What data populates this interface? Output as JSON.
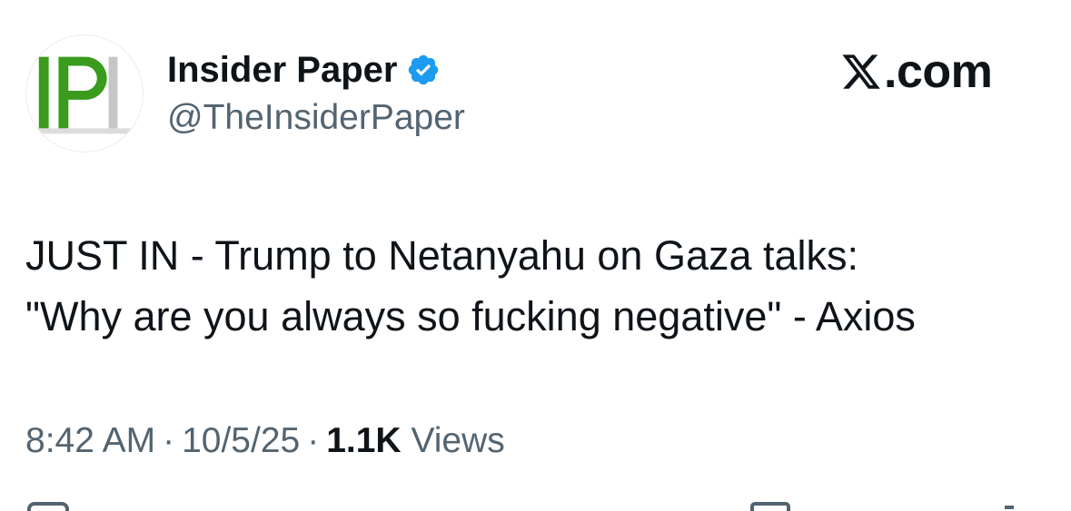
{
  "author": {
    "display_name": "Insider Paper",
    "handle": "@TheInsiderPaper",
    "avatar_text": "IP",
    "verified": true,
    "verified_color": "#1d9bf0",
    "avatar_accent": "#3a9b1c"
  },
  "brand": {
    "icon": "x-logo-icon",
    "suffix": ".com"
  },
  "tweet": {
    "lines": [
      "JUST IN - Trump to Netanyahu on Gaza talks:",
      "\"Why are you always so fucking negative\" - Axios"
    ]
  },
  "meta": {
    "time": "8:42 AM",
    "separator": "·",
    "date": "10/5/25",
    "views_count": "1.1K",
    "views_label": "Views"
  },
  "actions": [
    {
      "icon": "reply-icon"
    },
    {
      "icon": "bookmark-icon"
    },
    {
      "icon": "share-icon"
    }
  ]
}
